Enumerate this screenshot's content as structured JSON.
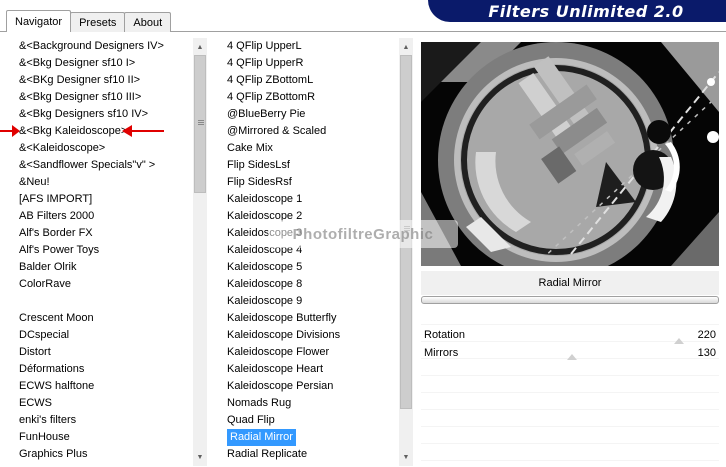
{
  "app": {
    "title": "Filters Unlimited 2.0"
  },
  "tabs": [
    {
      "label": "Navigator",
      "active": true
    },
    {
      "label": "Presets",
      "active": false
    },
    {
      "label": "About",
      "active": false
    }
  ],
  "categories": [
    "&<Background Designers IV>",
    "&<Bkg Designer sf10 I>",
    "&<BKg Designer sf10 II>",
    "&<Bkg Designer sf10 III>",
    "&<Bkg Designers sf10 IV>",
    "&<Bkg Kaleidoscope>",
    "&<Kaleidoscope>",
    "&<Sandflower Specials\"v\" >",
    "&Neu!",
    "[AFS IMPORT]",
    "AB Filters 2000",
    "Alf's Border FX",
    "Alf's Power Toys",
    "Balder Olrik",
    "ColorRave",
    "",
    "Crescent Moon",
    "DCspecial",
    "Distort",
    "Déformations",
    "ECWS halftone",
    "ECWS",
    "enki's filters",
    "FunHouse",
    "Graphics Plus"
  ],
  "filters": [
    "4 QFlip UpperL",
    "4 QFlip UpperR",
    "4 QFlip ZBottomL",
    "4 QFlip ZBottomR",
    "@BlueBerry Pie",
    "@Mirrored & Scaled",
    "Cake Mix",
    "Flip SidesLsf",
    "Flip SidesRsf",
    "Kaleidoscope 1",
    "Kaleidoscope 2",
    "Kaleidoscope 3",
    "Kaleidoscope 4",
    "Kaleidoscope 5",
    "Kaleidoscope 8",
    "Kaleidoscope 9",
    "Kaleidoscope Butterfly",
    "Kaleidoscope Divisions",
    "Kaleidoscope Flower",
    "Kaleidoscope Heart",
    "Kaleidoscope Persian",
    "Nomads Rug",
    "Quad Flip",
    "Radial Mirror",
    "Radial Replicate"
  ],
  "selected_filter": "Radial Mirror",
  "watermark": "PhotofiltreGraphic",
  "filter_name": "Radial Mirror",
  "params": [
    {
      "label": "Rotation",
      "value": "220"
    },
    {
      "label": "Mirrors",
      "value": "130"
    }
  ],
  "colors": {
    "banner": "#0a1a6a",
    "selection": "#3399ff",
    "annotation_arrow": "#e00000"
  }
}
